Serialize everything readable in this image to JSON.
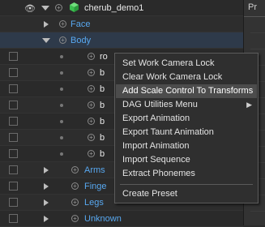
{
  "tree": {
    "root": {
      "label": "cherub_demo1"
    },
    "items": [
      {
        "label": "Face"
      },
      {
        "label": "Body"
      },
      {
        "label": "ro"
      },
      {
        "label": "b"
      },
      {
        "label": "b"
      },
      {
        "label": "b"
      },
      {
        "label": "b"
      },
      {
        "label": "b"
      },
      {
        "label": "b"
      },
      {
        "label": "Arms"
      },
      {
        "label": "Finge"
      },
      {
        "label": "Legs"
      },
      {
        "label": "Unknown"
      }
    ]
  },
  "right_panel": {
    "header": "Pr"
  },
  "context_menu": {
    "items": [
      {
        "label": "Set Work Camera Lock"
      },
      {
        "label": "Clear Work Camera Lock"
      },
      {
        "label": "Add Scale Control To Transforms"
      },
      {
        "label": "DAG Utilities Menu"
      },
      {
        "label": "Export Animation"
      },
      {
        "label": "Export Taunt Animation"
      },
      {
        "label": "Import Animation"
      },
      {
        "label": "Import Sequence"
      },
      {
        "label": "Extract Phonemes"
      },
      {
        "label": "Create Preset"
      }
    ],
    "highlighted": "Add Scale Control To Transforms",
    "submenu_item": "DAG Utilities Menu"
  },
  "colors": {
    "accent_blue": "#58a8f0",
    "cube_green": "#3cc050",
    "menu_highlight": "#4c4c4c"
  }
}
